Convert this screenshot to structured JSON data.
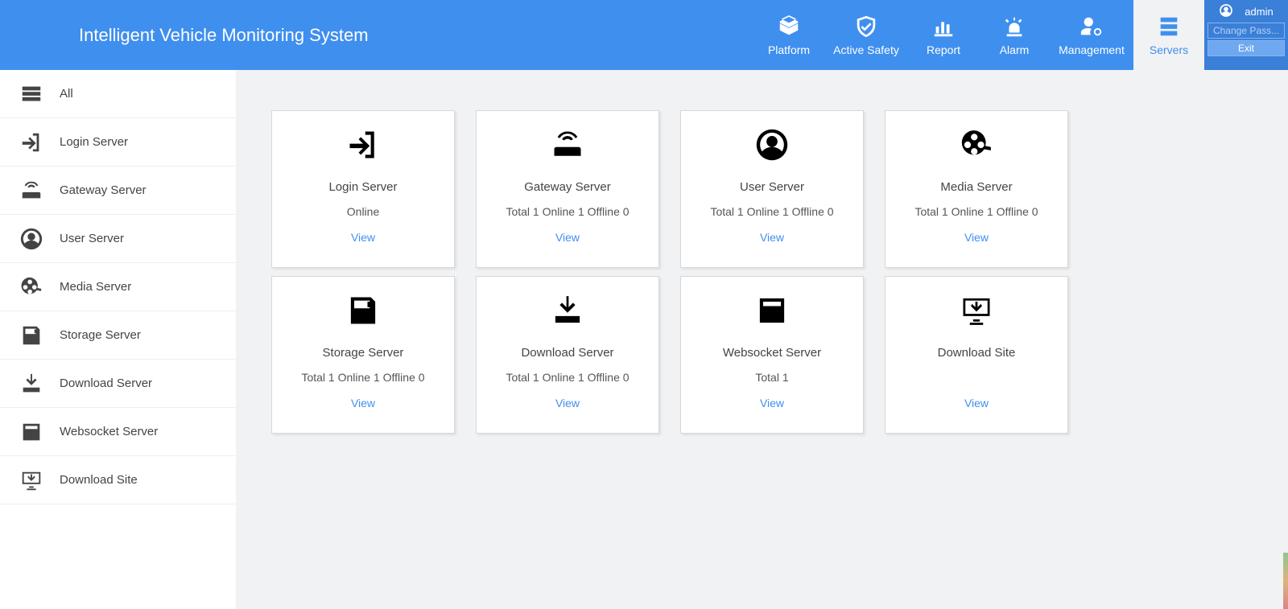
{
  "app_title": "Intelligent Vehicle Monitoring System",
  "colors": {
    "accent": "#3f8fef",
    "accent_dark": "#3a7fd8",
    "bg": "#f1f2f4"
  },
  "top_nav": {
    "items": [
      {
        "key": "platform",
        "label": "Platform",
        "icon": "cube-icon"
      },
      {
        "key": "safety",
        "label": "Active Safety",
        "icon": "shield-check-icon"
      },
      {
        "key": "report",
        "label": "Report",
        "icon": "bar-chart-icon"
      },
      {
        "key": "alarm",
        "label": "Alarm",
        "icon": "alarm-light-icon"
      },
      {
        "key": "management",
        "label": "Management",
        "icon": "user-gear-icon"
      },
      {
        "key": "servers",
        "label": "Servers",
        "icon": "server-rack-icon",
        "active": true
      }
    ]
  },
  "user_panel": {
    "username": "admin",
    "change_password_label": "Change Pass...",
    "exit_label": "Exit"
  },
  "sidebar": {
    "items": [
      {
        "key": "all",
        "label": "All",
        "icon": "all-servers-icon"
      },
      {
        "key": "login",
        "label": "Login Server",
        "icon": "login-arrow-icon"
      },
      {
        "key": "gateway",
        "label": "Gateway Server",
        "icon": "router-icon"
      },
      {
        "key": "user",
        "label": "User Server",
        "icon": "user-circle-icon"
      },
      {
        "key": "media",
        "label": "Media Server",
        "icon": "film-reel-icon"
      },
      {
        "key": "storage",
        "label": "Storage Server",
        "icon": "save-disk-icon"
      },
      {
        "key": "download",
        "label": "Download Server",
        "icon": "download-tray-icon"
      },
      {
        "key": "websocket",
        "label": "Websocket Server",
        "icon": "list-card-icon"
      },
      {
        "key": "site",
        "label": "Download Site",
        "icon": "download-monitor-icon"
      }
    ]
  },
  "cards": [
    {
      "key": "login",
      "title": "Login Server",
      "icon": "login-arrow-icon",
      "status": "Online",
      "view": "View"
    },
    {
      "key": "gateway",
      "title": "Gateway Server",
      "icon": "router-icon",
      "status": "Total 1 Online 1 Offline 0",
      "view": "View"
    },
    {
      "key": "user",
      "title": "User Server",
      "icon": "user-circle-icon",
      "status": "Total 1 Online 1 Offline 0",
      "view": "View"
    },
    {
      "key": "media",
      "title": "Media Server",
      "icon": "film-reel-icon",
      "status": "Total 1 Online 1 Offline 0",
      "view": "View"
    },
    {
      "key": "storage",
      "title": "Storage Server",
      "icon": "save-disk-icon",
      "status": "Total 1 Online 1 Offline 0",
      "view": "View"
    },
    {
      "key": "download",
      "title": "Download Server",
      "icon": "download-tray-icon",
      "status": "Total 1 Online 1 Offline 0",
      "view": "View"
    },
    {
      "key": "websocket",
      "title": "Websocket Server",
      "icon": "list-card-icon",
      "status": "Total 1",
      "view": "View"
    },
    {
      "key": "site",
      "title": "Download Site",
      "icon": "download-monitor-icon",
      "status": "",
      "view": "View"
    }
  ]
}
